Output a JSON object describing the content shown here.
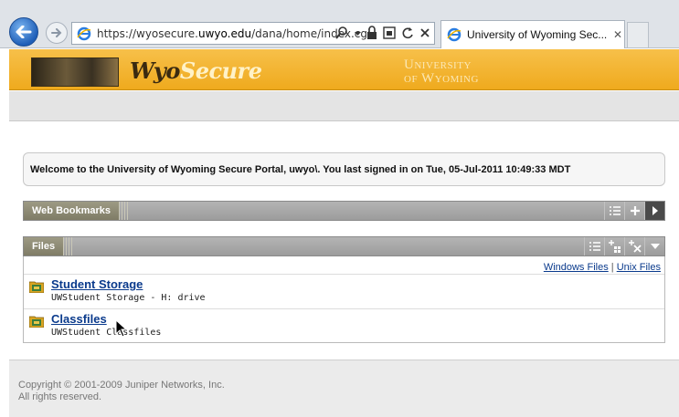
{
  "browser": {
    "address": {
      "prefix": "https://wyosecure.",
      "host": "uwyo.edu",
      "path": "/dana/home/index.cgi"
    },
    "tab_title": "University of Wyoming Sec...",
    "tab_close": "✕",
    "icons": [
      "back-arrow-icon",
      "forward-arrow-icon",
      "ie-icon",
      "search-icon",
      "lock-icon",
      "compat-icon",
      "refresh-icon",
      "stop-icon"
    ]
  },
  "banner": {
    "brand_part1": "Wyo",
    "brand_part2": "Secure",
    "university_line1": "University",
    "university_line2": "of Wyoming"
  },
  "welcome": {
    "text": "Welcome to the University of Wyoming Secure Portal, uwyo\\.  You last signed in on  Tue, 05-Jul-2011 10:49:33 MDT"
  },
  "web_bookmarks": {
    "title": "Web Bookmarks",
    "tools": [
      "list-icon",
      "add-icon",
      "collapse-arrow-icon"
    ]
  },
  "files": {
    "title": "Files",
    "tools": [
      "list-icon",
      "add-grid-icon",
      "remove-icon",
      "dropdown-icon"
    ],
    "links": {
      "windows": "Windows Files",
      "separator": "|",
      "unix": "Unix Files"
    },
    "items": [
      {
        "name": "Student Storage",
        "desc": "UWStudent Storage - H: drive"
      },
      {
        "name": "Classfiles",
        "desc": "UWStudent Classfiles"
      }
    ]
  },
  "footer": {
    "line1": "Copyright © 2001-2009 Juniper Networks, Inc.",
    "line2": "All rights reserved."
  },
  "colors": {
    "banner": "#efaa1e",
    "link": "#0a3a8c",
    "panel_header": "#9c9c9c"
  }
}
